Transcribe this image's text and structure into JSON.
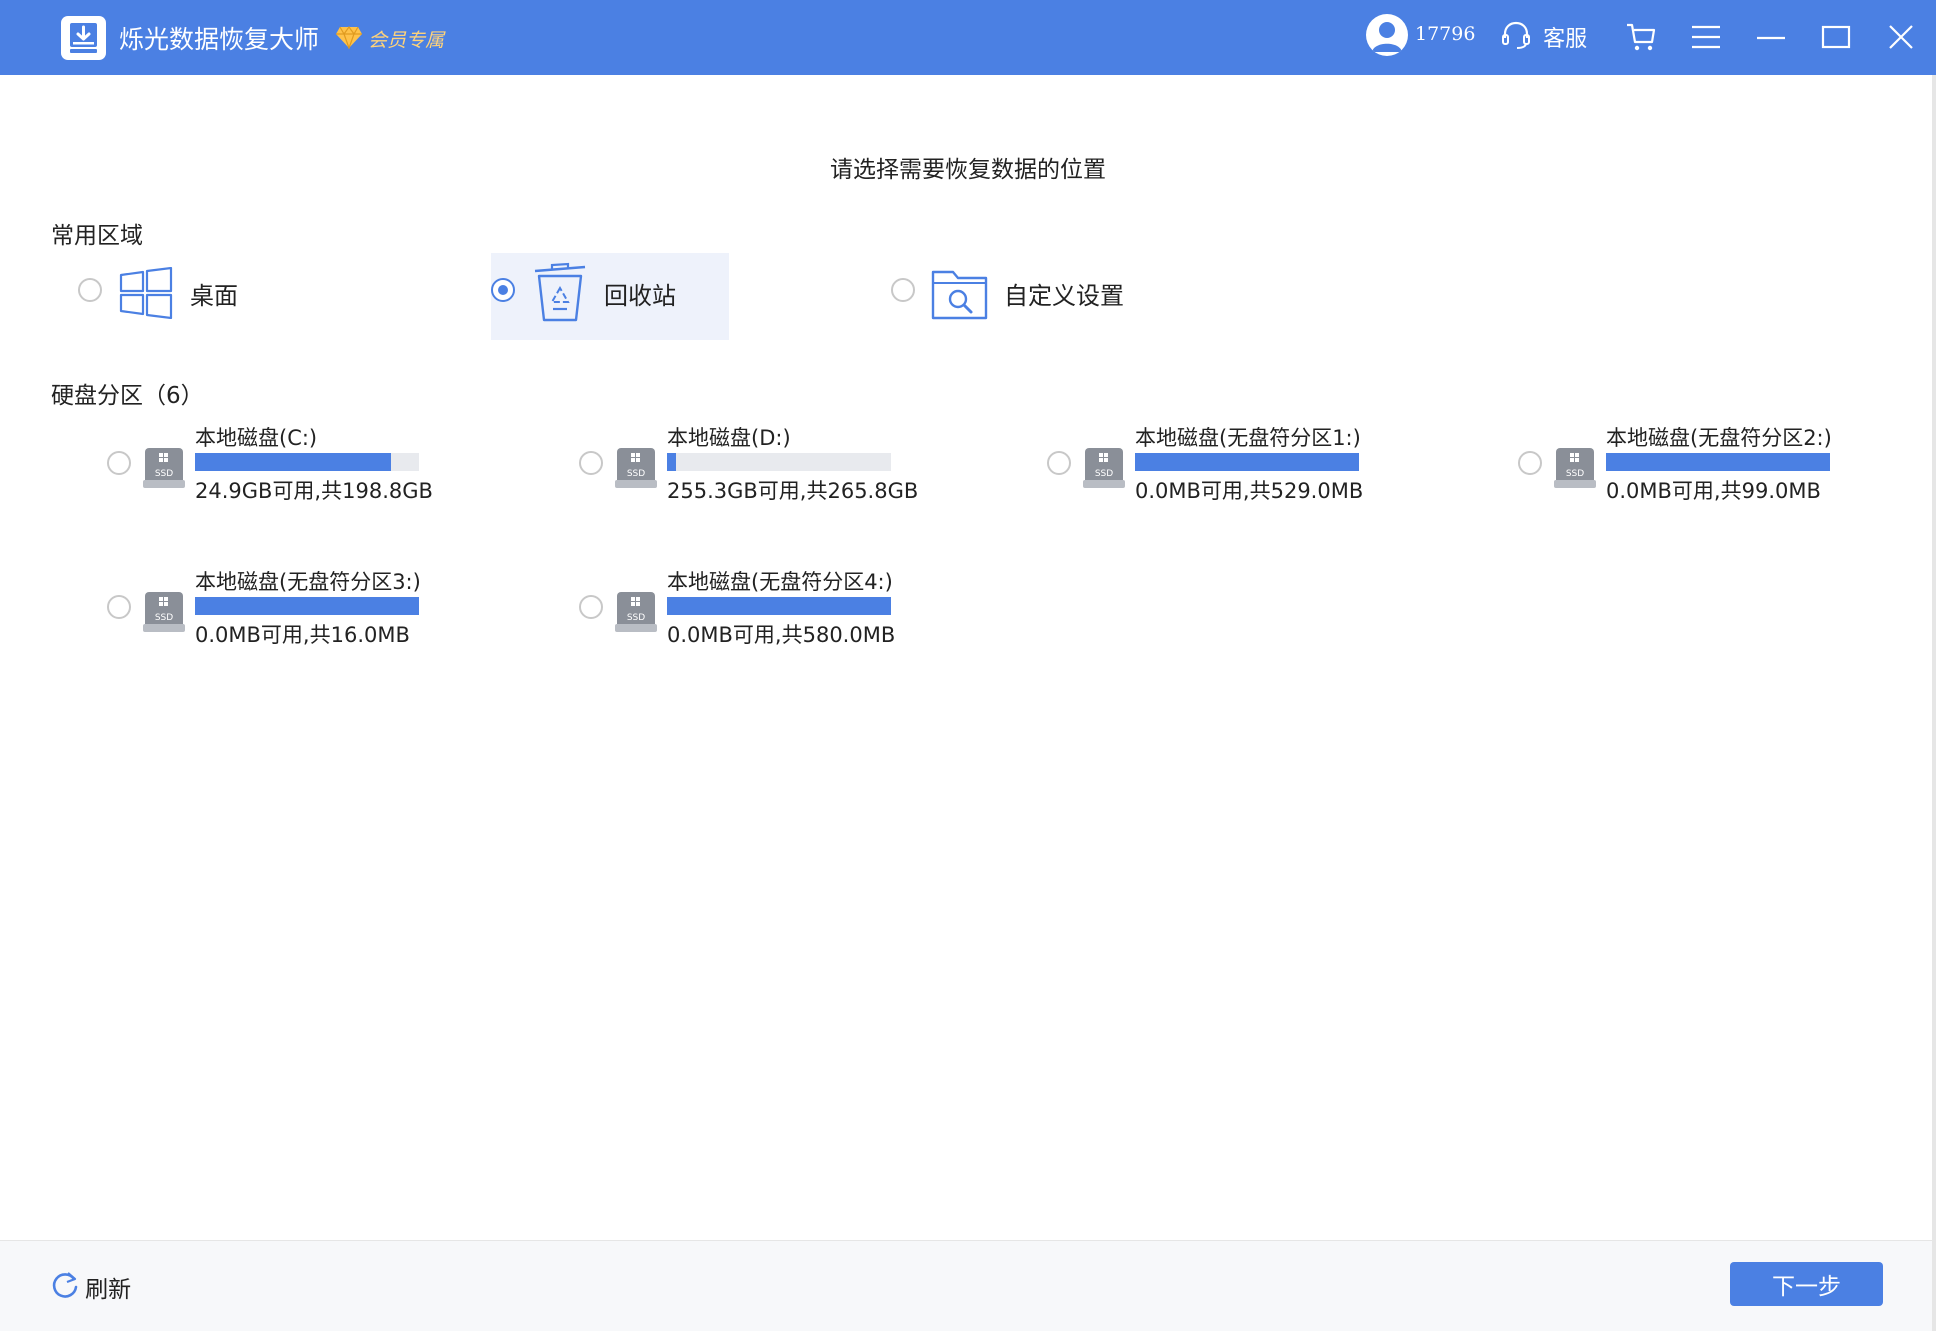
{
  "titlebar": {
    "app_name": "烁光数据恢复大师",
    "vip_label": "会员专属",
    "user_id": "17796",
    "support_label": "客服",
    "icons": [
      "app-logo-icon",
      "diamond-icon",
      "avatar-icon",
      "headset-icon",
      "cart-icon",
      "menu-icon",
      "minimize-icon",
      "maximize-icon",
      "close-icon"
    ]
  },
  "main": {
    "title": "请选择需要恢复数据的位置",
    "common_section": {
      "title": "常用区域",
      "items": [
        {
          "label": "桌面",
          "icon": "windows-icon",
          "selected": false
        },
        {
          "label": "回收站",
          "icon": "recycle-bin-icon",
          "selected": true
        },
        {
          "label": "自定义设置",
          "icon": "folder-search-icon",
          "selected": false
        }
      ]
    },
    "disk_section": {
      "title": "硬盘分区（6）",
      "drives": [
        {
          "name": "本地磁盘(C:)",
          "size_text": "24.9GB可用,共198.8GB",
          "used_fraction": 0.875,
          "badge": "SSD"
        },
        {
          "name": "本地磁盘(D:)",
          "size_text": "255.3GB可用,共265.8GB",
          "used_fraction": 0.04,
          "badge": "SSD"
        },
        {
          "name": "本地磁盘(无盘符分区1:)",
          "size_text": "0.0MB可用,共529.0MB",
          "used_fraction": 1.0,
          "badge": "SSD"
        },
        {
          "name": "本地磁盘(无盘符分区2:)",
          "size_text": "0.0MB可用,共99.0MB",
          "used_fraction": 1.0,
          "badge": "SSD"
        },
        {
          "name": "本地磁盘(无盘符分区3:)",
          "size_text": "0.0MB可用,共16.0MB",
          "used_fraction": 1.0,
          "badge": "SSD"
        },
        {
          "name": "本地磁盘(无盘符分区4:)",
          "size_text": "0.0MB可用,共580.0MB",
          "used_fraction": 1.0,
          "badge": "SSD"
        }
      ]
    }
  },
  "footer": {
    "refresh_label": "刷新",
    "next_label": "下一步"
  },
  "colors": {
    "accent": "#4b80e3",
    "vip": "#ffd37a",
    "bar_track": "#e8eaee"
  }
}
